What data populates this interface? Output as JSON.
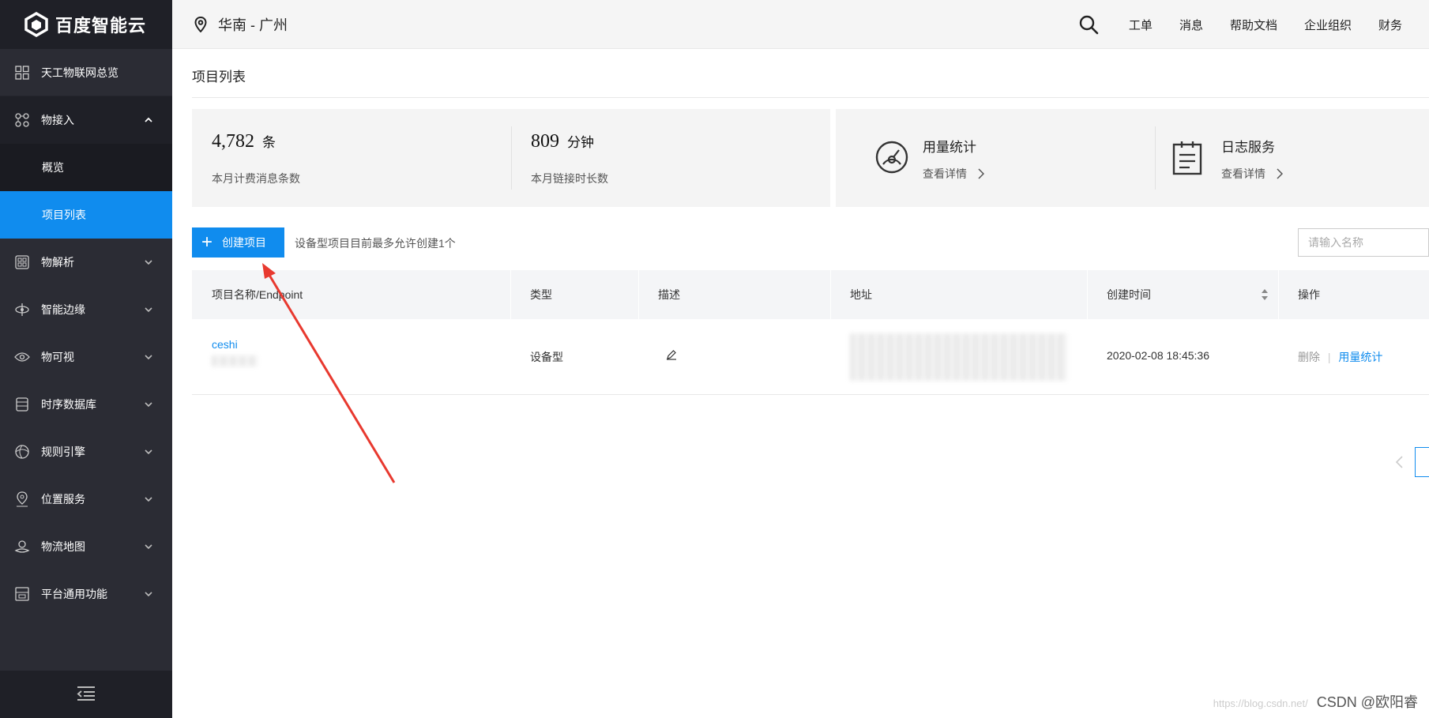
{
  "brand": {
    "name": "百度智能云"
  },
  "topbar": {
    "region": "华南 - 广州",
    "links": [
      "工单",
      "消息",
      "帮助文档",
      "企业组织",
      "财务"
    ]
  },
  "sidebar": {
    "overview": "天工物联网总览",
    "items": [
      {
        "label": "物接入",
        "icon": "device-access-icon",
        "open": true
      },
      {
        "label": "物解析",
        "icon": "parse-icon"
      },
      {
        "label": "智能边缘",
        "icon": "edge-icon"
      },
      {
        "label": "物可视",
        "icon": "eye-icon"
      },
      {
        "label": "时序数据库",
        "icon": "database-icon"
      },
      {
        "label": "规则引擎",
        "icon": "rules-icon"
      },
      {
        "label": "位置服务",
        "icon": "location-icon"
      },
      {
        "label": "物流地图",
        "icon": "map-icon"
      },
      {
        "label": "平台通用功能",
        "icon": "platform-icon"
      }
    ],
    "subitems": [
      {
        "label": "概览",
        "active": false
      },
      {
        "label": "项目列表",
        "active": true
      }
    ]
  },
  "page": {
    "title": "项目列表"
  },
  "stats": {
    "messages": {
      "value": "4,782",
      "unit": "条",
      "label": "本月计费消息条数"
    },
    "duration": {
      "value": "809",
      "unit": "分钟",
      "label": "本月链接时长数"
    }
  },
  "services": [
    {
      "title": "用量统计",
      "link": "查看详情",
      "icon": "gauge-icon"
    },
    {
      "title": "日志服务",
      "link": "查看详情",
      "icon": "clipboard-icon"
    }
  ],
  "toolbar": {
    "create_label": "创建项目",
    "hint": "设备型项目目前最多允许创建1个",
    "search_placeholder": "请输入名称"
  },
  "table": {
    "columns": [
      "项目名称/Endpoint",
      "类型",
      "描述",
      "地址",
      "创建时间",
      "操作"
    ],
    "rows": [
      {
        "name": "ceshi",
        "type": "设备型",
        "created": "2020-02-08 18:45:36",
        "actions": [
          "删除",
          "用量统计"
        ]
      }
    ]
  },
  "watermark": {
    "faint": "https://blog.csdn.net/",
    "text": "CSDN @欧阳睿"
  },
  "colors": {
    "accent": "#108cee",
    "sidebar": "#2b2c34",
    "arrow": "#e8392f"
  }
}
